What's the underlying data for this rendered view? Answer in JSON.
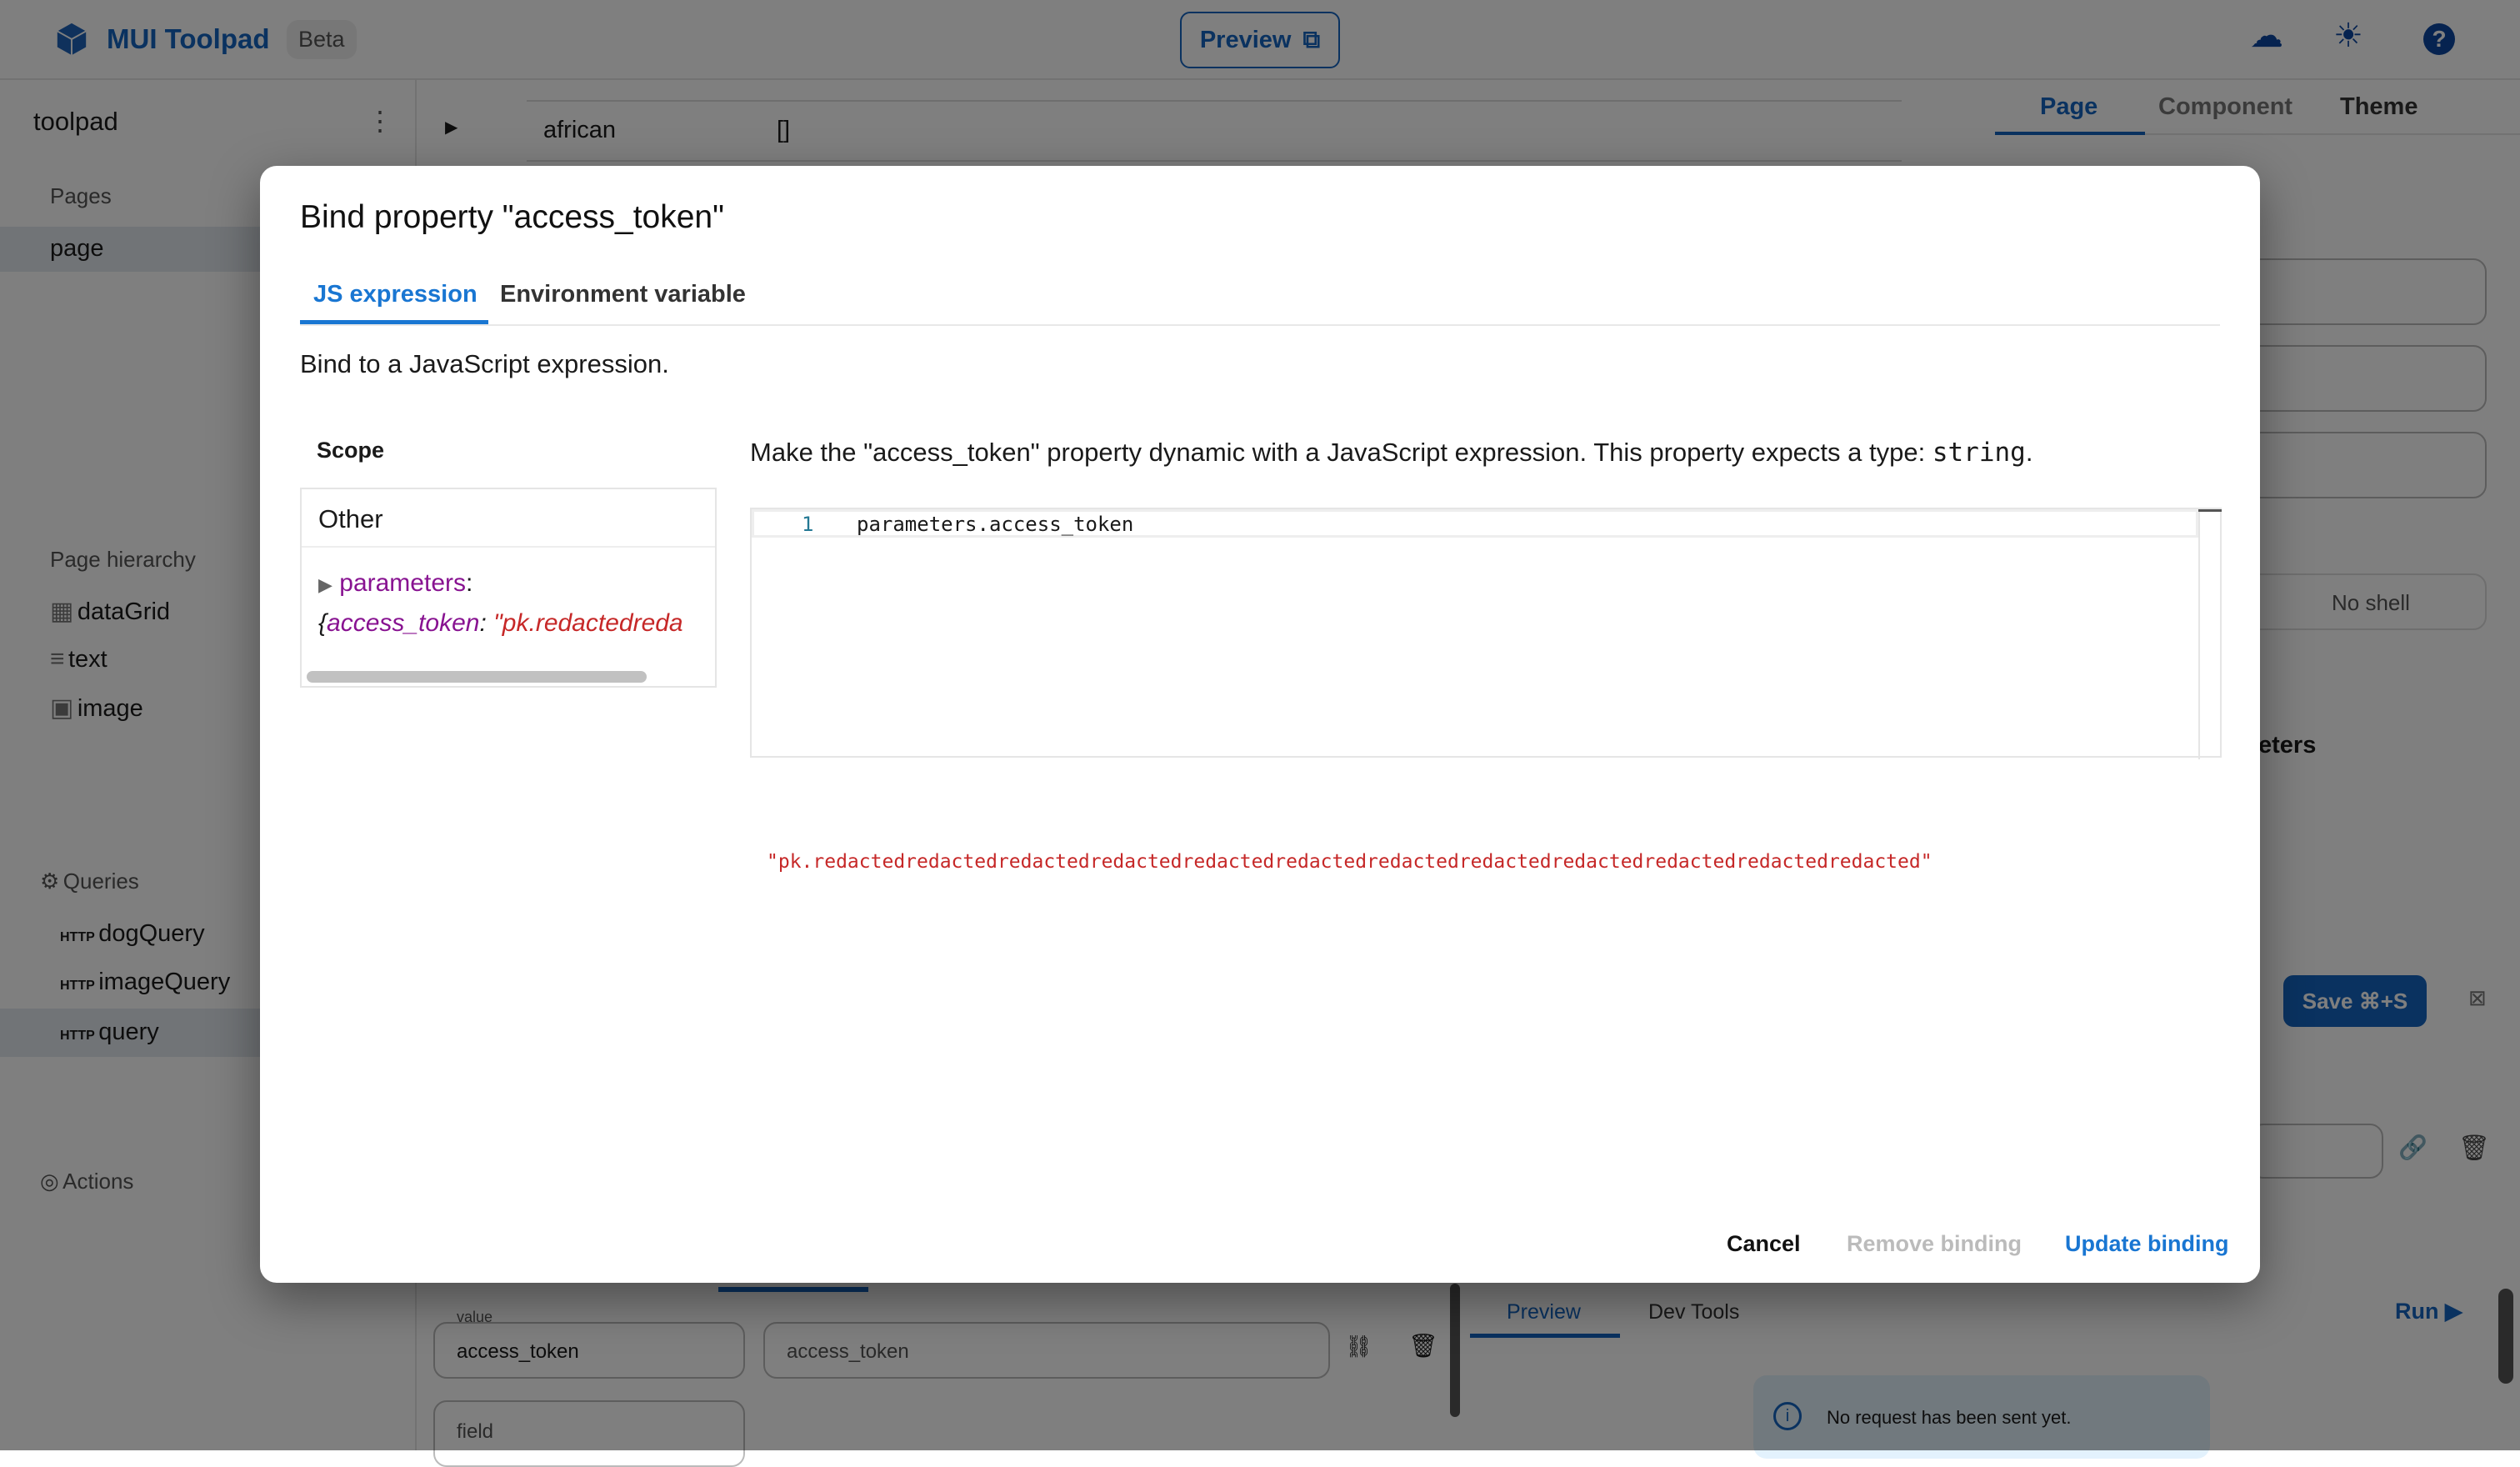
{
  "header": {
    "brand": "MUI Toolpad",
    "badge": "Beta",
    "preview_label": "Preview",
    "icons": [
      "cloud-check-icon",
      "sun-icon",
      "help-icon"
    ]
  },
  "sidebar": {
    "app_name": "toolpad",
    "pages_label": "Pages",
    "pages": [
      "page"
    ],
    "hierarchy_label": "Page hierarchy",
    "hierarchy": [
      {
        "icon": "grid-icon",
        "label": "dataGrid"
      },
      {
        "icon": "text-icon",
        "label": "text"
      },
      {
        "icon": "image-icon",
        "label": "image"
      }
    ],
    "queries_label": "Queries",
    "queries": [
      {
        "method": "HTTP",
        "label": "dogQuery"
      },
      {
        "method": "HTTP",
        "label": "imageQuery"
      },
      {
        "method": "HTTP",
        "label": "query"
      }
    ],
    "actions_label": "Actions"
  },
  "canvas": {
    "row_label": "african",
    "row_value": "[]"
  },
  "right_panel": {
    "tabs": [
      "Page",
      "Component",
      "Theme"
    ],
    "no_shell": "No shell",
    "parameters_partial": "eters",
    "save_label": "Save ⌘+S"
  },
  "query_editor": {
    "value_label": "value",
    "param_name": "access_token",
    "param_value": "access_token",
    "field_label": "field",
    "tabs": [
      "Preview",
      "Dev Tools"
    ],
    "run_label": "Run",
    "info": "No request has been sent yet."
  },
  "dialog": {
    "title": "Bind property \"access_token\"",
    "tabs": [
      "JS expression",
      "Environment variable"
    ],
    "description": "Bind to a JavaScript expression.",
    "scope_label": "Scope",
    "scope_group": "Other",
    "scope_key": "parameters",
    "scope_preview_key": "access_token",
    "scope_preview_value": "\"pk.redactedreda",
    "instruction": "Make the \"access_token\" property dynamic with a JavaScript expression. This property expects a type: ",
    "type": "string",
    "line_number": "1",
    "code": "parameters.access_token",
    "result": "\"pk.redactedredactedredactedredactedredactedredactedredactedredactedredactedredactedredactedredacted\"",
    "cancel": "Cancel",
    "remove": "Remove binding",
    "update": "Update binding"
  },
  "colors": {
    "primary": "#1976d2",
    "dark_primary": "#1565c0",
    "error": "#c62828",
    "key_purple": "#881391"
  }
}
